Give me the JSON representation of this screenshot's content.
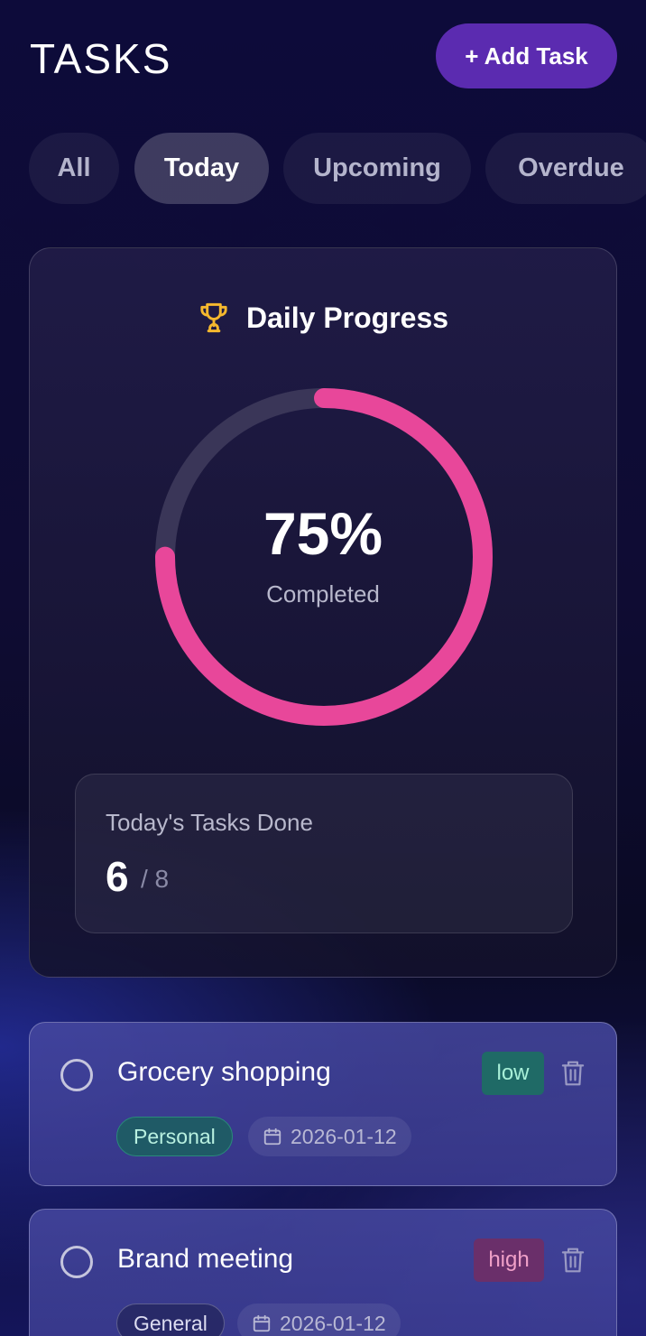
{
  "header": {
    "title": "TASKS",
    "add_button": "+ Add Task"
  },
  "tabs": [
    {
      "label": "All",
      "active": false
    },
    {
      "label": "Today",
      "active": true
    },
    {
      "label": "Upcoming",
      "active": false
    },
    {
      "label": "Overdue",
      "active": false
    }
  ],
  "progress": {
    "title": "Daily Progress",
    "icon": "trophy-icon",
    "percent_label": "75%",
    "percent_value": 75,
    "caption": "Completed",
    "done_label": "Today's Tasks Done",
    "done_count": "6",
    "done_total": "/ 8",
    "ring_color": "#e8479a",
    "track_color": "#3a3658",
    "icon_color": "#f5b82e"
  },
  "tasks": [
    {
      "title": "Grocery shopping",
      "priority": "low",
      "category": "Personal",
      "date": "2026-01-12"
    },
    {
      "title": "Brand meeting",
      "priority": "high",
      "category": "General",
      "date": "2026-01-12"
    }
  ]
}
